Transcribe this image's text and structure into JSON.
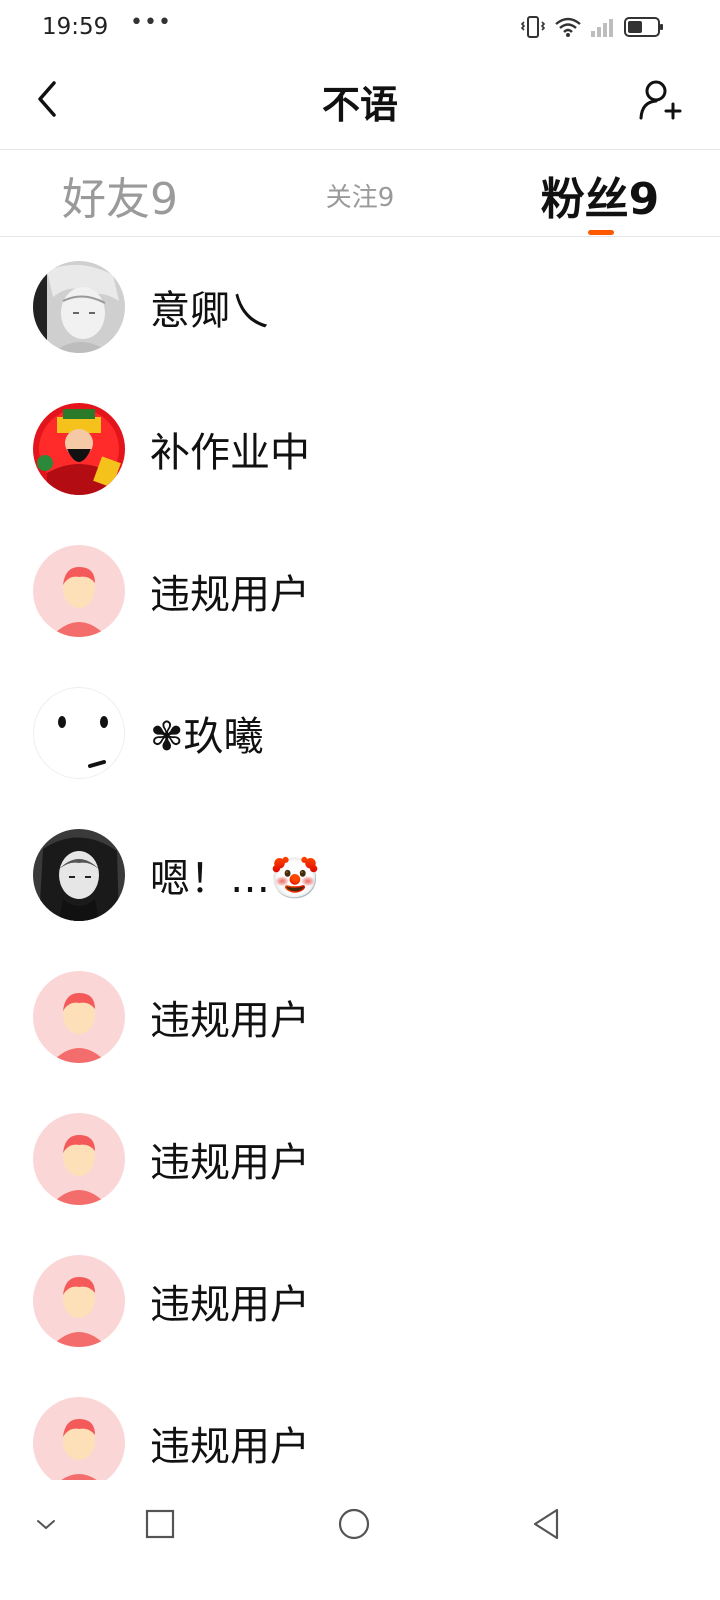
{
  "status_bar": {
    "time": "19:59",
    "dots": "•••",
    "icons": [
      "vibrate-icon",
      "wifi-icon",
      "signal-icon",
      "battery-icon"
    ]
  },
  "header": {
    "title": "不语",
    "back_icon": "chevron-left-icon",
    "action_icon": "add-user-icon"
  },
  "tabs": {
    "items": [
      {
        "label": "好友9",
        "selected": false
      },
      {
        "label": "关注9",
        "selected": false
      },
      {
        "label": "粉丝9",
        "selected": true
      }
    ],
    "accent_color": "#ff5a00"
  },
  "fans": [
    {
      "name": "意卿乀",
      "avatar": "anime-grey-avatar"
    },
    {
      "name": "补作业中",
      "avatar": "god-of-wealth-avatar"
    },
    {
      "name": "违规用户",
      "avatar": "default-user-avatar"
    },
    {
      "name": "✾玖曦",
      "avatar": "face-dots-avatar"
    },
    {
      "name": "嗯！…🤡",
      "avatar": "anime-bw-girl-avatar"
    },
    {
      "name": "违规用户",
      "avatar": "default-user-avatar"
    },
    {
      "name": "违规用户",
      "avatar": "default-user-avatar"
    },
    {
      "name": "违规用户",
      "avatar": "default-user-avatar"
    },
    {
      "name": "违规用户",
      "avatar": "default-user-avatar"
    }
  ],
  "nav_bar": {
    "icons": [
      "chevron-down-icon",
      "square-icon",
      "circle-icon",
      "triangle-back-icon"
    ]
  }
}
